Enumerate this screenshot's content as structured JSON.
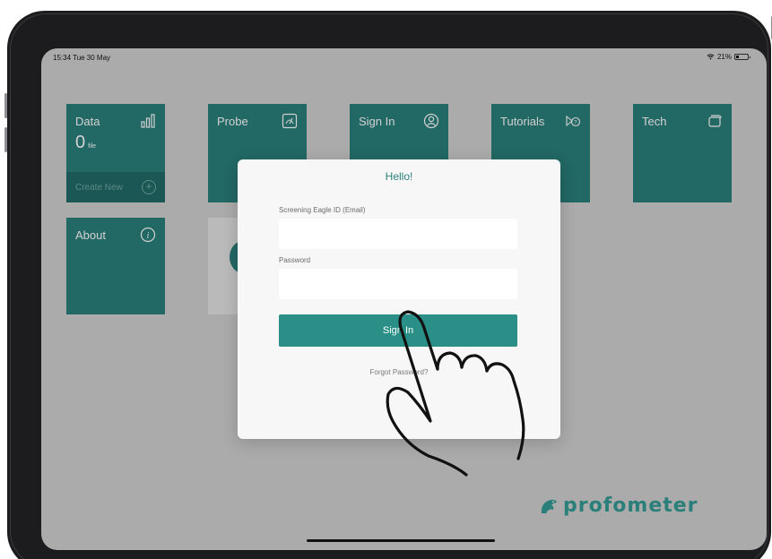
{
  "status_bar": {
    "time": "15:34  Tue 30 May",
    "battery": "21%"
  },
  "tiles": [
    {
      "id": "data",
      "label": "Data",
      "icon": "bar-chart-icon",
      "count": "0",
      "unit": "file",
      "footer_label": "Create New",
      "footer_icon": "plus-circle-icon"
    },
    {
      "id": "probe",
      "label": "Probe",
      "icon": "gauge-icon"
    },
    {
      "id": "signin",
      "label": "Sign In",
      "icon": "user-circle-icon"
    },
    {
      "id": "tutorials",
      "label": "Tutorials",
      "icon": "video-help-icon"
    },
    {
      "id": "tech",
      "label": "Tech",
      "icon": "cards-icon"
    },
    {
      "id": "about",
      "label": "About",
      "icon": "info-circle-icon",
      "icon_glyph": "i"
    }
  ],
  "modal": {
    "title": "Hello!",
    "email_label": "Screening Eagle ID (Email)",
    "email_value": "",
    "password_label": "Password",
    "password_value": "",
    "submit_label": "Sign In",
    "forgot_link": "Forgot Password?"
  },
  "brand": {
    "logo_text": "profometer",
    "accent_color": "#2a7f7a"
  }
}
